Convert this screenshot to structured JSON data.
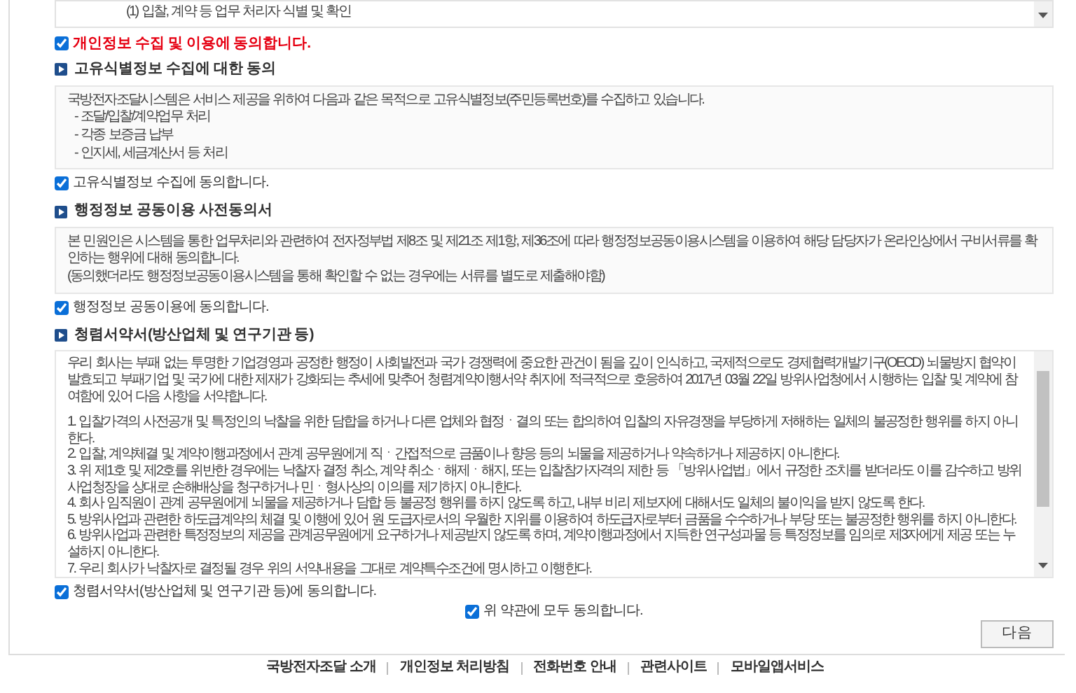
{
  "top_box": {
    "lines": [
      "(1) 입찰, 계약 등 업무 처리자 식별 및 확인"
    ]
  },
  "top_consent": {
    "label": "개인정보 수집 및 이용에 동의합니다.",
    "checked": true,
    "emphasis": true
  },
  "sections": [
    {
      "title": "고유식별정보 수집에 대한 동의",
      "scrollable": false,
      "paragraphs": [
        "국방전자조달시스템은 서비스 제공을 위하여 다음과 같은 목적으로 고유식별정보(주민등록번호)를 수집하고 있습니다.",
        "  - 조달/입찰/계약업무 처리",
        "  - 각종 보증금 납부",
        "  - 인지세, 세금계산서 등 처리"
      ],
      "consent": {
        "label": "고유식별정보 수집에 동의합니다.",
        "checked": true
      }
    },
    {
      "title": "행정정보 공동이용 사전동의서",
      "scrollable": false,
      "paragraphs": [
        "본 민원인은 시스템을 통한 업무처리와 관련하여 전자정부법 제8조 및 제21조 제1항, 제36조에 따라 행정정보공동이용시스템을 이용하여 해당 담당자가 온라인상에서 구비서류를 확인하는 행위에 대해 동의합니다.",
        "(동의했더라도 행정정보공동이용시스템을 통해 확인할 수 없는 경우에는 서류를 별도로 제출해야함)"
      ],
      "consent": {
        "label": "행정정보 공동이용에 동의합니다.",
        "checked": true
      }
    },
    {
      "title": "청렴서약서(방산업체 및 연구기관 등)",
      "scrollable": true,
      "paragraphs": [
        "우리 회사는 부패 없는 투명한 기업경영과 공정한 행정이 사회발전과 국가 경쟁력에 중요한 관건이 됨을 깊이 인식하고, 국제적으로도 경제협력개발기구(OECD) 뇌물방지 협약이 발효되고 부패기업 및 국가에 대한 제재가 강화되는 추세에 맞추어 청렴계약이행서약 취지에 적극적으로 호응하여 2017년 03월 22일 방위사업청에서 시행하는 입찰 및 계약에 참여함에 있어 다음 사항을 서약합니다.",
        "1. 입찰가격의 사전공개 및 특정인의 낙찰을 위한 담합을 하거나 다른 업체와 협정ㆍ결의 또는 합의하여 입찰의 자유경쟁을 부당하게 저해하는 일체의 불공정한 행위를 하지 아니한다.",
        "2. 입찰, 계약체결 및 계약이행과정에서 관계 공무원에게 직ㆍ간접적으로 금품이나 향응 등의 뇌물을 제공하거나 약속하거나 제공하지 아니한다.",
        "3. 위 제1호 및 제2호를 위반한 경우에는 낙찰자 결정 취소, 계약 취소ㆍ해제ㆍ해지, 또는 입찰참가자격의 제한 등 「방위사업법」에서 규정한 조치를 받더라도 이를 감수하고 방위사업청장을 상대로 손해배상을 청구하거나 민ㆍ형사상의 이의를 제기하지 아니한다.",
        "4. 회사 임직원이 관계 공무원에게 뇌물을 제공하거나 담합 등 불공정 행위를 하지 않도록 하고, 내부 비리 제보자에 대해서도 일체의 불이익을 받지 않도록 한다.",
        "5. 방위사업과 관련한 하도급계약의 체결 및 이행에 있어 원 도급자로서의 우월한 지위를 이용하여 하도급자로부터 금품을 수수하거나 부당 또는 불공정한 행위를 하지 아니한다.",
        "6. 방위사업과 관련한 특정정보의 제공을 관계공무원에게 요구하거나 제공받지 않도록 하며, 계약이행과정에서 지득한 연구성과물 등 특정정보를 임의로 제3자에게 제공 또는 누설하지 아니한다.",
        "7. 우리 회사가 낙찰자로 결정될 경우 위의 서약내용을 그대로 계약특수조건에 명시하고 이행한다."
      ],
      "consent": {
        "label": "청렴서약서(방산업체 및 연구기관 등)에 동의합니다.",
        "checked": true
      }
    }
  ],
  "agree_all": {
    "label": "위 약관에 모두 동의합니다.",
    "checked": true
  },
  "next_button": "다음",
  "footer_links": [
    "국방전자조달 소개",
    "개인정보 처리방침",
    "전화번호 안내",
    "관련사이트",
    "모바일앱서비스"
  ]
}
